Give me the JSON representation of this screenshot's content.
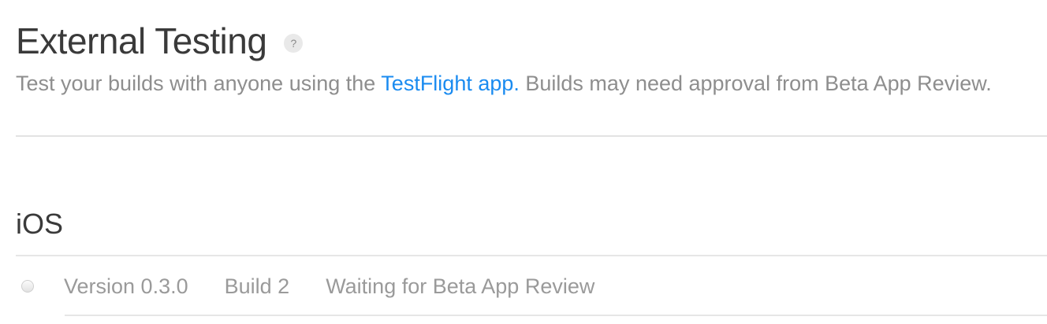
{
  "header": {
    "title": "External Testing",
    "help_icon": "?"
  },
  "subtitle": {
    "prefix": "Test your builds with anyone using the ",
    "link": "TestFlight app.",
    "suffix": " Builds may need approval from Beta App Review."
  },
  "section": {
    "title": "iOS"
  },
  "builds": [
    {
      "version": "Version 0.3.0",
      "build": "Build 2",
      "status": "Waiting for Beta App Review"
    }
  ],
  "colors": {
    "link": "#1a8bf0",
    "muted_text": "#8e8e8e",
    "heading_text": "#3a3a3a",
    "divider": "#e3e3e3"
  }
}
